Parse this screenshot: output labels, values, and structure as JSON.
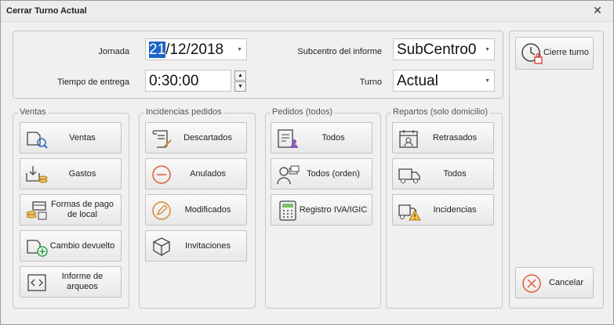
{
  "window": {
    "title": "Cerrar Turno Actual",
    "close_glyph": "✕"
  },
  "form": {
    "jornada_label": "Jornada",
    "jornada_sel": "21",
    "jornada_rest": "/12/2018",
    "tiempo_label": "Tiempo de entrega",
    "tiempo_value": "0:30:00",
    "subcentro_label": "Subcentro del informe",
    "subcentro_value": "SubCentro0",
    "turno_label": "Turno",
    "turno_value": "Actual"
  },
  "groups": {
    "ventas": {
      "title": "Ventas",
      "buttons": [
        "Ventas",
        "Gastos",
        "Formas de pago de local",
        "Cambio devuelto",
        "Informe de arqueos"
      ]
    },
    "incidencias": {
      "title": "Incidencias pedidos",
      "buttons": [
        "Descartados",
        "Anulados",
        "Modificados",
        "Invitaciones"
      ]
    },
    "pedidos": {
      "title": "Pedidos (todos)",
      "buttons": [
        "Todos",
        "Todos (orden)",
        "Registro IVA/IGIC"
      ]
    },
    "repartos": {
      "title": "Repartos (solo domicilio)",
      "buttons": [
        "Retrasados",
        "Todos",
        "Incidencias"
      ]
    }
  },
  "actions": {
    "cierre": "Cierre turno",
    "cancelar": "Cancelar"
  },
  "colors": {
    "accent_blue": "#1e64c8",
    "cancel_red": "#e05a3a",
    "icon_gray": "#444444"
  }
}
